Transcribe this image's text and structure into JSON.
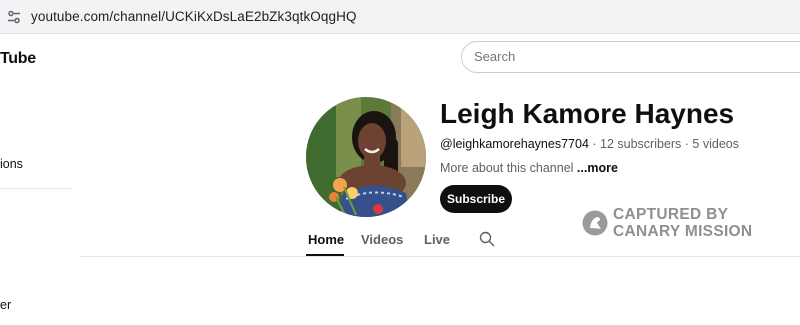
{
  "browser": {
    "url": "youtube.com/channel/UCKiKxDsLaE2bZk3qtkOqgHQ"
  },
  "sidebar": {
    "logo_text": "Tube",
    "items": [
      {
        "label": "ions"
      },
      {
        "label": "er"
      }
    ]
  },
  "search": {
    "placeholder": "Search"
  },
  "channel": {
    "name": "Leigh Kamore Haynes",
    "handle": "@leighkamorehaynes7704",
    "subscribers": "12 subscribers",
    "videos": "5 videos",
    "separator": " · ",
    "about": "More about this channel",
    "more": "...more",
    "subscribe_label": "Subscribe"
  },
  "tabs": [
    {
      "label": "Home",
      "active": true
    },
    {
      "label": "Videos",
      "active": false
    },
    {
      "label": "Live",
      "active": false
    }
  ],
  "watermark": {
    "line1": "CAPTURED BY",
    "line2": "CANARY MISSION"
  },
  "icons": {
    "site_settings": "tune-icon",
    "tab_search": "search-icon",
    "watermark": "canary-bird-icon"
  },
  "colors": {
    "text_primary": "#0f0f0f",
    "text_secondary": "#606060",
    "subscribe_bg": "#0f0f0f",
    "watermark": "#8f8f8f"
  }
}
